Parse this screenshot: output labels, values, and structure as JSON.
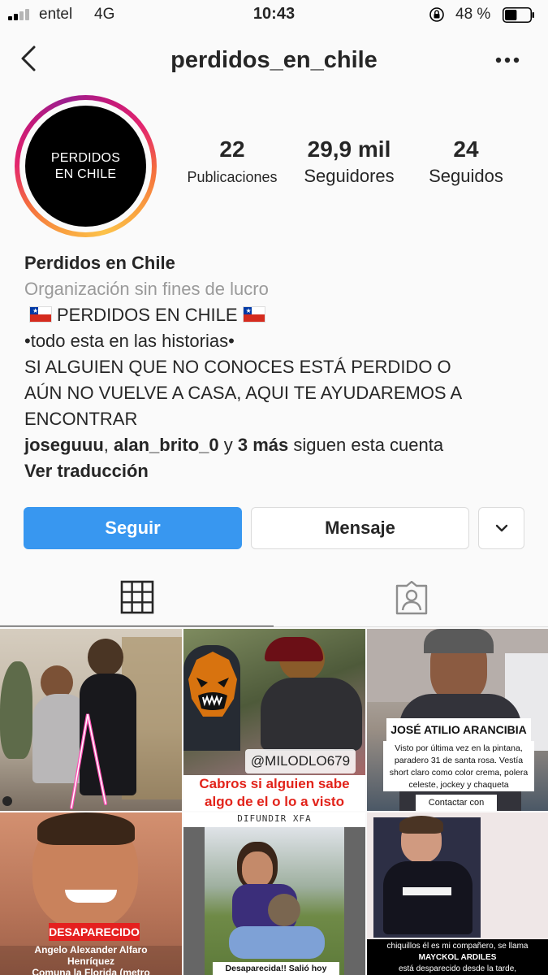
{
  "status_bar": {
    "carrier": "entel",
    "network": "4G",
    "time": "10:43",
    "battery": "48 %",
    "battery_level": 0.48
  },
  "nav": {
    "title": "perdidos_en_chile"
  },
  "avatar": {
    "line1": "PERDIDOS",
    "line2": "EN CHILE"
  },
  "stats": {
    "posts_count": "22",
    "posts_label": "Publicaciones",
    "followers_count": "29,9 mil",
    "followers_label": "Seguidores",
    "following_count": "24",
    "following_label": "Seguidos"
  },
  "bio": {
    "name": "Perdidos en Chile",
    "category": "Organización sin fines de lucro",
    "headline": "PERDIDOS EN CHILE",
    "line2": "•todo esta en las historias•",
    "line3": "SI ALGUIEN QUE NO CONOCES ESTÁ PERDIDO O",
    "line4": "AÚN NO VUELVE A CASA, AQUI TE AYUDAREMOS A",
    "line5": "ENCONTRAR",
    "followed_user1": "joseguuu",
    "followed_sep": ",",
    "followed_user2": "alan_brito_0",
    "followed_and": "y",
    "followed_more": "3 más",
    "followed_suffix": "siguen esta cuenta",
    "translate": "Ver traducción"
  },
  "buttons": {
    "follow": "Seguir",
    "message": "Mensaje"
  },
  "posts": {
    "p2_tag": "@MILODLO679",
    "p2_caption_1": "Cabros si alguien sabe",
    "p2_caption_2": "algo de el o lo a visto",
    "p3_name": "JOSÉ ATILIO ARANCIBIA",
    "p3_text_1": "Visto por última vez en la pintana,",
    "p3_text_2": "paradero 31 de santa rosa. Vestía",
    "p3_text_3": "short claro como color crema, polera",
    "p3_text_4": "celeste, jockey y chaqueta",
    "p3_contact": "Contactar con",
    "p4_label": "DESAPARECIDO",
    "p4_text_1": "Angelo Alexander Alfaro",
    "p4_text_2": "Henríquez",
    "p4_text_3": "Comuna la Florida (metro",
    "p5_top": "DIFUNDIR XFA",
    "p5_caption": "Desaparecida!! Salió hoy desde su",
    "p6_text_1": "chiquillos él es mi compañero, se llama",
    "p6_text_2": "MAYCKOL ARDILES",
    "p6_text_3": "está desparecido desde la tarde,"
  },
  "colors": {
    "follow_button": "#3897f0",
    "text": "#262626",
    "muted": "#9a9a9a",
    "background": "#fafafa"
  },
  "icons": {
    "back": "chevron-left-icon",
    "more": "more-horizontal-icon",
    "dropdown": "chevron-down-icon",
    "grid": "grid-icon",
    "tagged": "tagged-person-icon"
  }
}
